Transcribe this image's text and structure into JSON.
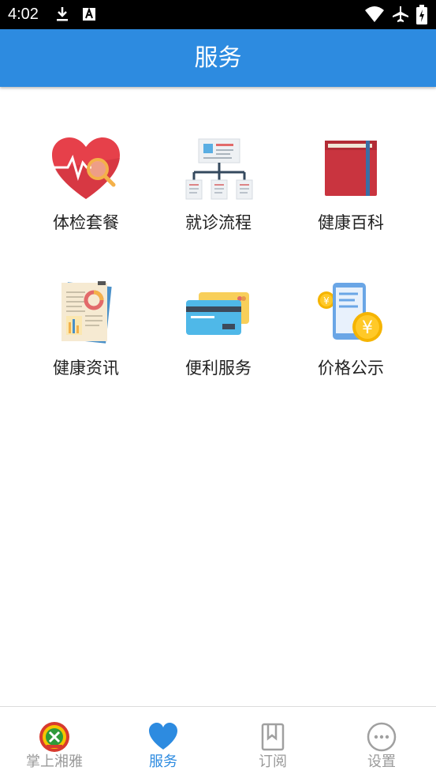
{
  "status_bar": {
    "time": "4:02",
    "icons": [
      "download-icon",
      "text-a-icon",
      "wifi-icon",
      "airplane-icon",
      "battery-icon"
    ]
  },
  "app_bar": {
    "title": "服务"
  },
  "services": [
    {
      "label": "体检套餐",
      "icon": "heart-checkup-icon"
    },
    {
      "label": "就诊流程",
      "icon": "flowchart-icon"
    },
    {
      "label": "健康百科",
      "icon": "book-icon"
    },
    {
      "label": "健康资讯",
      "icon": "report-document-icon"
    },
    {
      "label": "便利服务",
      "icon": "bank-card-icon"
    },
    {
      "label": "价格公示",
      "icon": "phone-price-icon"
    }
  ],
  "bottom_nav": {
    "items": [
      {
        "label": "掌上湘雅",
        "icon": "xiangya-logo-icon"
      },
      {
        "label": "服务",
        "icon": "heart-icon",
        "active": true
      },
      {
        "label": "订阅",
        "icon": "bookmark-icon"
      },
      {
        "label": "设置",
        "icon": "more-dots-icon"
      }
    ]
  },
  "colors": {
    "app_bar": "#2d8be0",
    "active_tab": "#2d8be0",
    "inactive_tab": "#9a9a9a"
  }
}
